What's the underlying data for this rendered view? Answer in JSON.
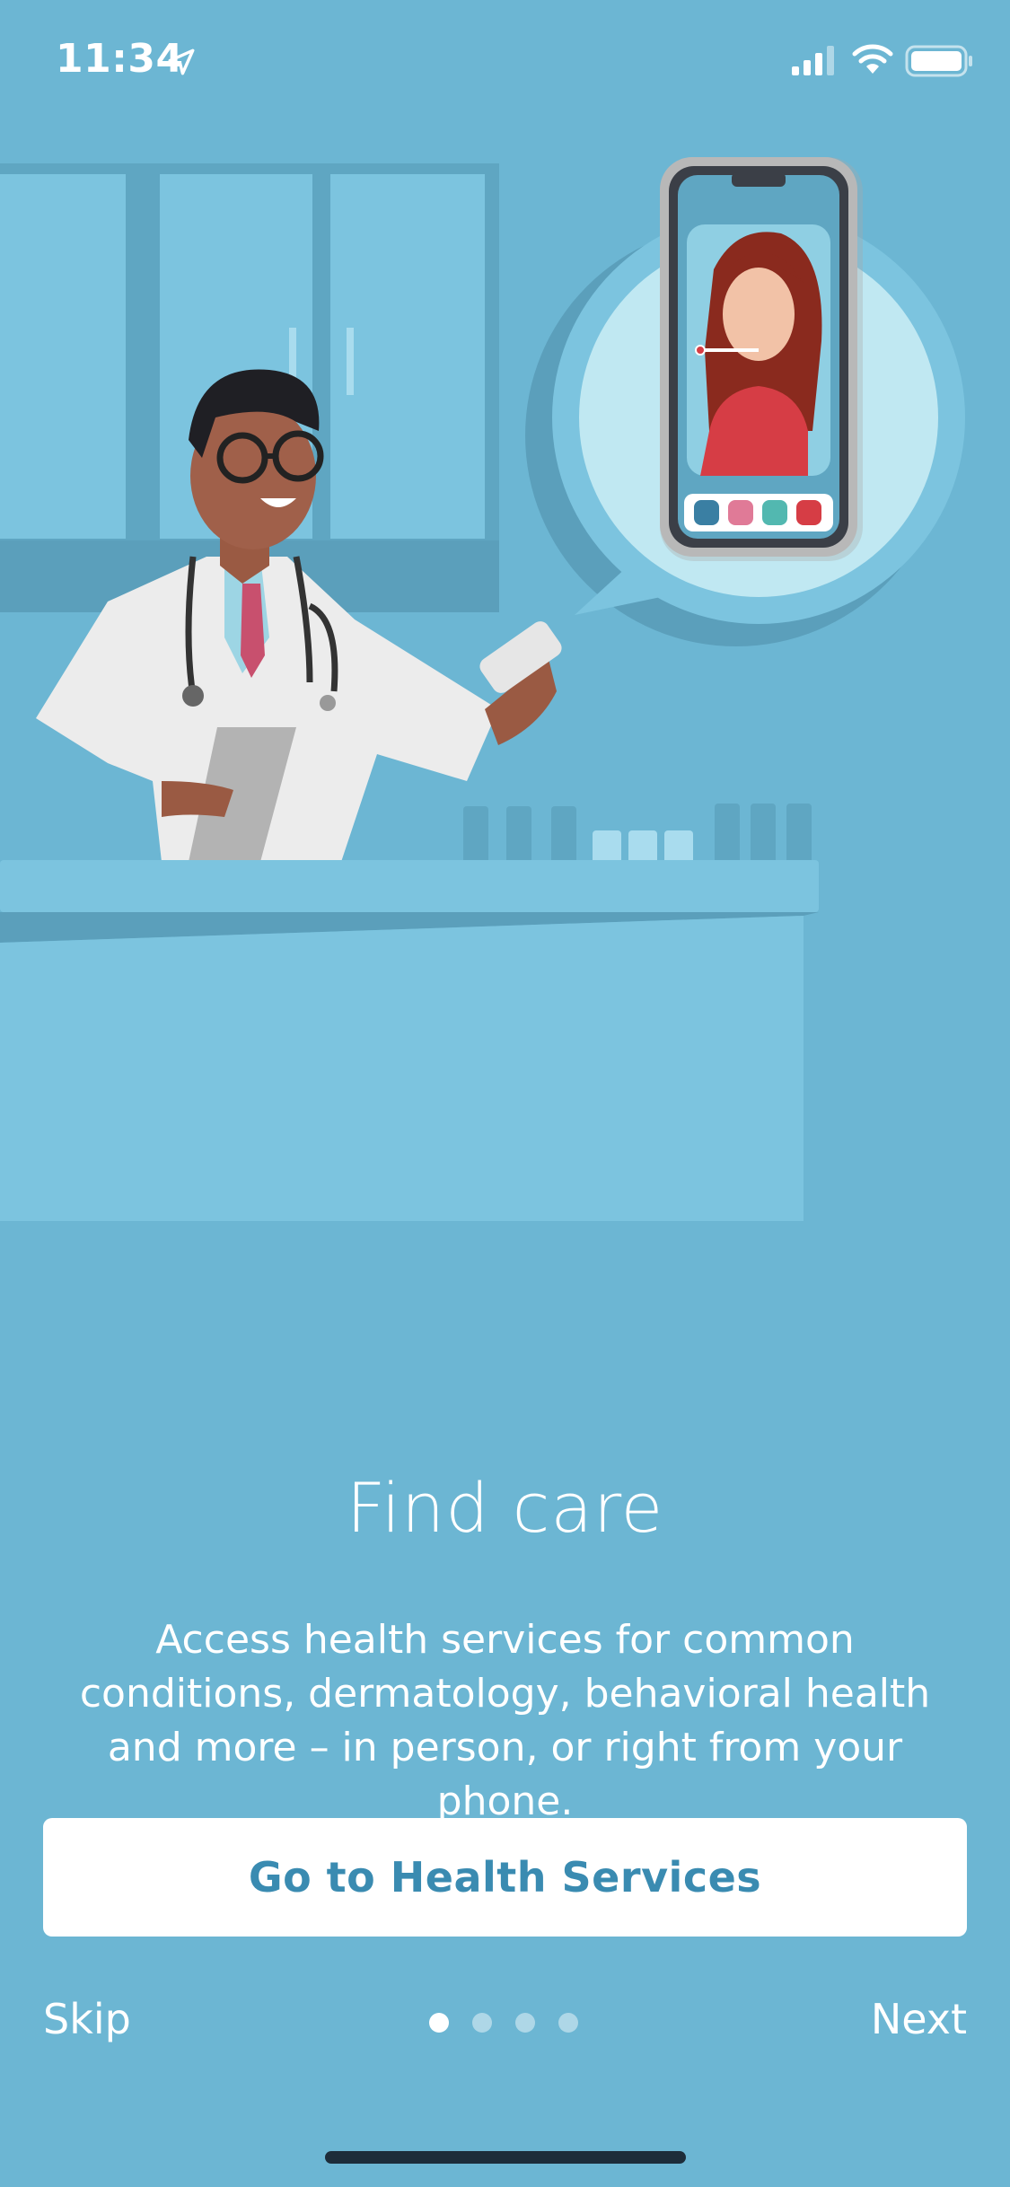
{
  "status_bar": {
    "time": "11:34",
    "icons": [
      "location-arrow-icon",
      "cellular-signal-icon",
      "wifi-icon",
      "battery-icon"
    ]
  },
  "illustration": {
    "description_icon": "doctor-telehealth-illustration"
  },
  "onboarding": {
    "title": "Find care",
    "description": "Access health services for common conditions, dermatology, behavioral health and more – in person, or right from your phone.",
    "cta_label": "Go to Health Services",
    "skip_label": "Skip",
    "next_label": "Next",
    "page_count": 4,
    "current_page": 1
  },
  "colors": {
    "background": "#6cb6d3",
    "cta_text": "#3a8bb1",
    "cta_background": "#ffffff"
  }
}
